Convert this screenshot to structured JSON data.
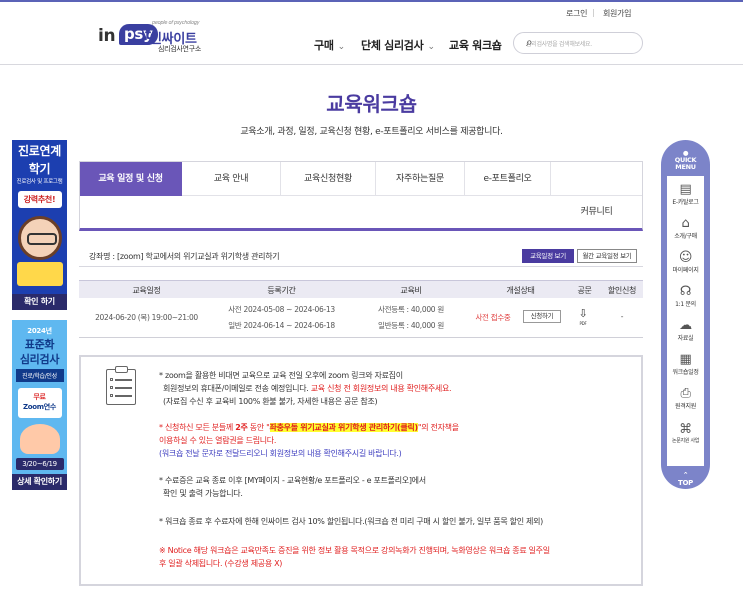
{
  "header": {
    "login": "로그인",
    "signup": "회원가입",
    "logo_tagline": "people of psychology",
    "logo_en": "in",
    "logo_psy": "psy",
    "logo_t": "t",
    "logo_kr": "인싸이트",
    "logo_sub": "심리검사연구소",
    "nav": [
      {
        "label": "구매"
      },
      {
        "label": "단체 심리검사"
      },
      {
        "label": "교육 워크숍"
      }
    ],
    "search_placeholder": "심리검사명을 검색해보세요."
  },
  "page": {
    "title": "교육워크숍",
    "subtitle": "교육소개, 과정, 일정, 교육신청 현황, e-포트폴리오 서비스를 제공합니다."
  },
  "tabs": {
    "row1": [
      "교육 일정 및 신청",
      "교육 안내",
      "교육신청현황",
      "자주하는질문",
      "e-포트폴리오"
    ],
    "row2": [
      "커뮤니티"
    ]
  },
  "course": {
    "label": "강좌명 : [zoom] 학교에서의 위기교실과 위기학생 관리하기",
    "btn_schedule": "교육일정 보기",
    "btn_monthly": "월간 교육일정 보기"
  },
  "table": {
    "headers": [
      "교육일정",
      "등록기간",
      "교육비",
      "개설상태",
      "공문",
      "할인신청"
    ],
    "row": {
      "date": "2024-06-20 (목) 19:00~21:00",
      "period1": "사전 2024-05-08 ~ 2024-06-13",
      "period2": "일반 2024-06-14 ~ 2024-06-18",
      "fee1": "사전등록 : 40,000 원",
      "fee2": "일반등록 : 40,000 원",
      "status": "사전 접수중",
      "apply": "신청하기",
      "doc_label": "PDF",
      "discount": "-"
    }
  },
  "notice": {
    "p1a": "* zoom을 활용한 비대면 교육으로 교육 전일 오후에 zoom 링크와 자료집이",
    "p1b_pre": "회원정보의 휴대폰/이메일로 전송 예정입니다. ",
    "p1b_red": "교육 신청 전 회원정보의 내용 확인해주세요.",
    "p1c": "(자료집 수신 후 교육비 100% 환불 불가, 자세한 내용은 공문 참조)",
    "p2a_pre": "* 신청하신 모든 분들께 ",
    "p2a_b": "2주",
    "p2a_mid": " 동안 \"",
    "p2a_hl": "좌충우돌 위기교실과 위기학생 관리하기(클릭)",
    "p2a_post": "\"의 전자책을",
    "p2b": "이용하실 수 있는 열람권을 드립니다.",
    "p2c": "(워크숍 전날 문자로 전달드리오니 회원정보의 내용 확인해주시길 바랍니다.)",
    "p3a": "* 수료증은 교육 종료 이후 [MY페이지 - 교육현황/e 포트폴리오 - e 포트폴리오]에서",
    "p3b": "확인 및 출력 가능합니다.",
    "p4": "* 워크숍 종료 후 수료자에 한해 인싸이트 검사 10% 할인됩니다.(워크숍 전 미리 구매 시 할인 불가, 일부 품목 할인 제외)",
    "p5a": "※ Notice 해당 워크숍은 교육만족도 증진을 위한 정보 활용 목적으로 강의녹화가 진행되며, 녹화영상은 워크숍 종료 일주일",
    "p5b": "후 일괄 삭제됩니다. (수강생 제공용 X)"
  },
  "banner_left1": {
    "title1": "진로연계",
    "title2": "학기",
    "sub": "진로검사 및 프로그램",
    "pill": "강력추천!",
    "foot": "확인 하기"
  },
  "banner_left2": {
    "year": "2024년",
    "title1": "표준화",
    "title2": "심리검사",
    "sub": "진로/학습/인성",
    "free": "무료",
    "free2": "Zoom연수",
    "date": "3/20~6/19",
    "foot": "상세 확인하기"
  },
  "quick_menu": {
    "head1": "QUICK",
    "head2": "MENU",
    "items": [
      "E-카탈로그",
      "소개/구매",
      "마이페이지",
      "1:1 문의",
      "자료실",
      "워크숍일정",
      "원격지원",
      "논문지원 사업"
    ],
    "top": "TOP"
  },
  "colors": {
    "accent": "#6a56b8",
    "title": "#4a3ba0",
    "red": "#e02020",
    "highlight": "#ffff30",
    "quick": "#7c84c9"
  }
}
